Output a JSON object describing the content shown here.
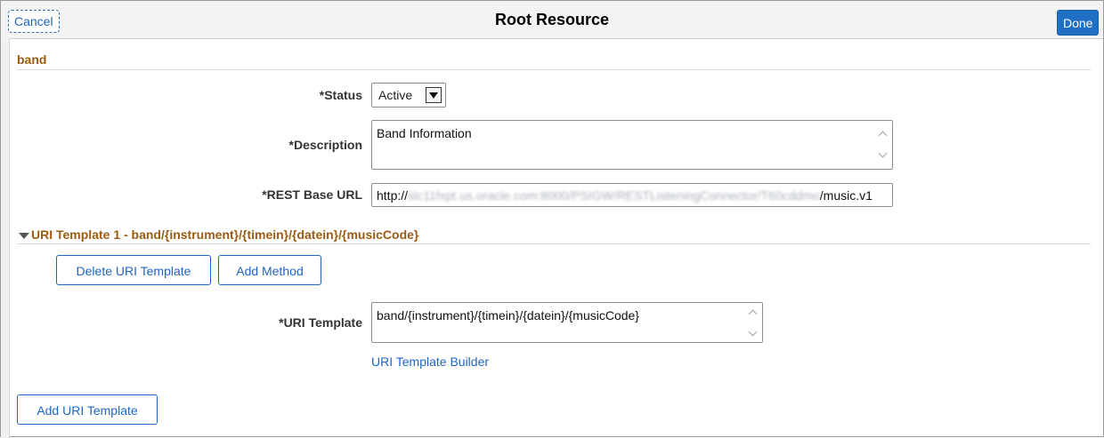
{
  "header": {
    "cancel_label": "Cancel",
    "title": "Root Resource",
    "done_label": "Done"
  },
  "resource": {
    "section_title": "band",
    "status": {
      "label": "*Status",
      "value": "Active"
    },
    "description": {
      "label": "*Description",
      "value": "Band Information"
    },
    "rest_base_url": {
      "label": "*REST Base URL",
      "prefix": "http://",
      "host_obscured": "slc11fxpt.us.oracle.com:8000/PSIGW/RESTListeningConnector/T60cddmo",
      "suffix": "/music.v1"
    }
  },
  "uri_template_section": {
    "title": "URI Template 1 - band/{instrument}/{timein}/{datein}/{musicCode}",
    "delete_button": "Delete URI Template",
    "add_method_button": "Add Method",
    "uri_template": {
      "label": "*URI Template",
      "value": "band/{instrument}/{timein}/{datein}/{musicCode}"
    },
    "builder_link": "URI Template Builder"
  },
  "footer": {
    "add_uri_template_button": "Add URI Template"
  },
  "colors": {
    "section_title": "#9a5b13",
    "primary": "#1f6fc5",
    "link": "#1f66c0"
  }
}
